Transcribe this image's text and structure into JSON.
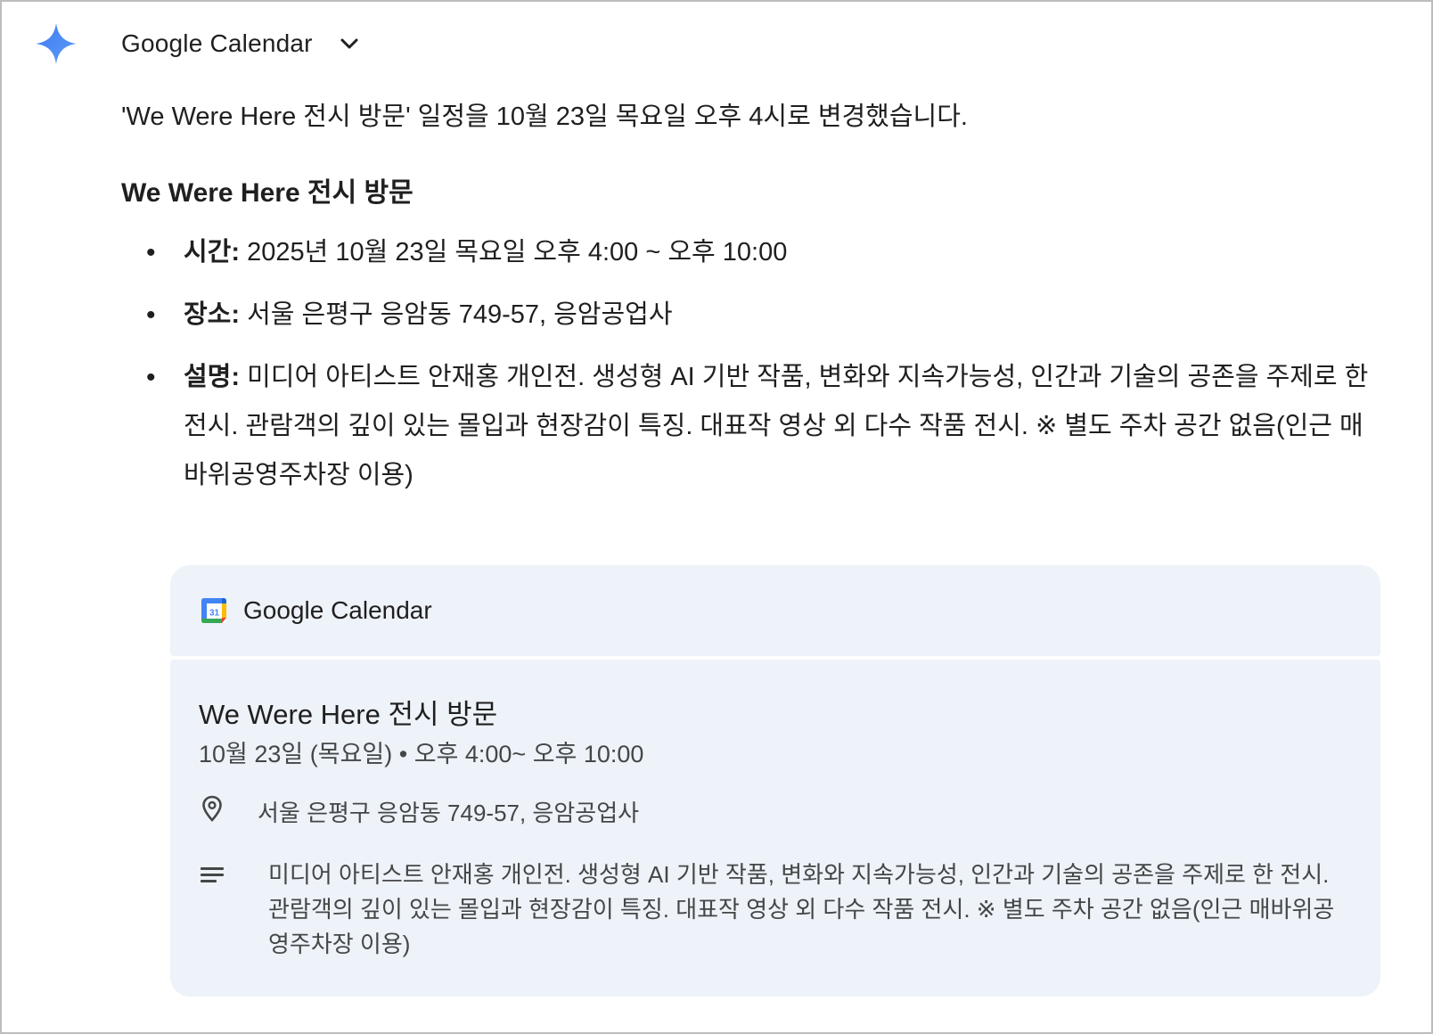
{
  "header": {
    "service_name": "Google Calendar",
    "icon": "gemini-spark-icon",
    "dropdown_icon": "chevron-down-icon"
  },
  "response": {
    "summary": "'We Were Here 전시 방문' 일정을 10월 23일 목요일 오후 4시로 변경했습니다.",
    "event_title": "We Were Here 전시 방문",
    "details": [
      {
        "label": "시간:",
        "value": "2025년 10월 23일 목요일 오후 4:00 ~ 오후 10:00"
      },
      {
        "label": "장소:",
        "value": "서울 은평구 응암동 749-57, 응암공업사"
      },
      {
        "label": "설명:",
        "value": "미디어 아티스트 안재홍 개인전. 생성형 AI 기반 작품, 변화와 지속가능성, 인간과 기술의 공존을 주제로 한 전시. 관람객의 깊이 있는 몰입과 현장감이 특징. 대표작 영상 외 다수 작품 전시. ※ 별도 주차 공간 없음(인근 매바위공영주차장 이용)"
      }
    ]
  },
  "card": {
    "app_name": "Google Calendar",
    "app_icon": "google-calendar-icon",
    "event_title": "We Were Here 전시 방문",
    "date_time": "10월 23일 (목요일) • 오후 4:00~ 오후 10:00",
    "location": "서울 은평구 응암동 749-57, 응암공업사",
    "location_icon": "location-pin-icon",
    "description": "미디어 아티스트 안재홍 개인전. 생성형 AI 기반 작품, 변화와 지속가능성, 인간과 기술의 공존을 주제로 한 전시. 관람객의 깊이 있는 몰입과 현장감이 특징. 대표작 영상 외 다수 작품 전시. ※ 별도 주차 공간 없음(인근 매바위공영주차장 이용)",
    "description_icon": "notes-icon"
  },
  "colors": {
    "card_background": "#eef2f9",
    "spark_blue": "#4a8af4",
    "text_primary": "#1f1f1f",
    "text_secondary": "#444746"
  }
}
